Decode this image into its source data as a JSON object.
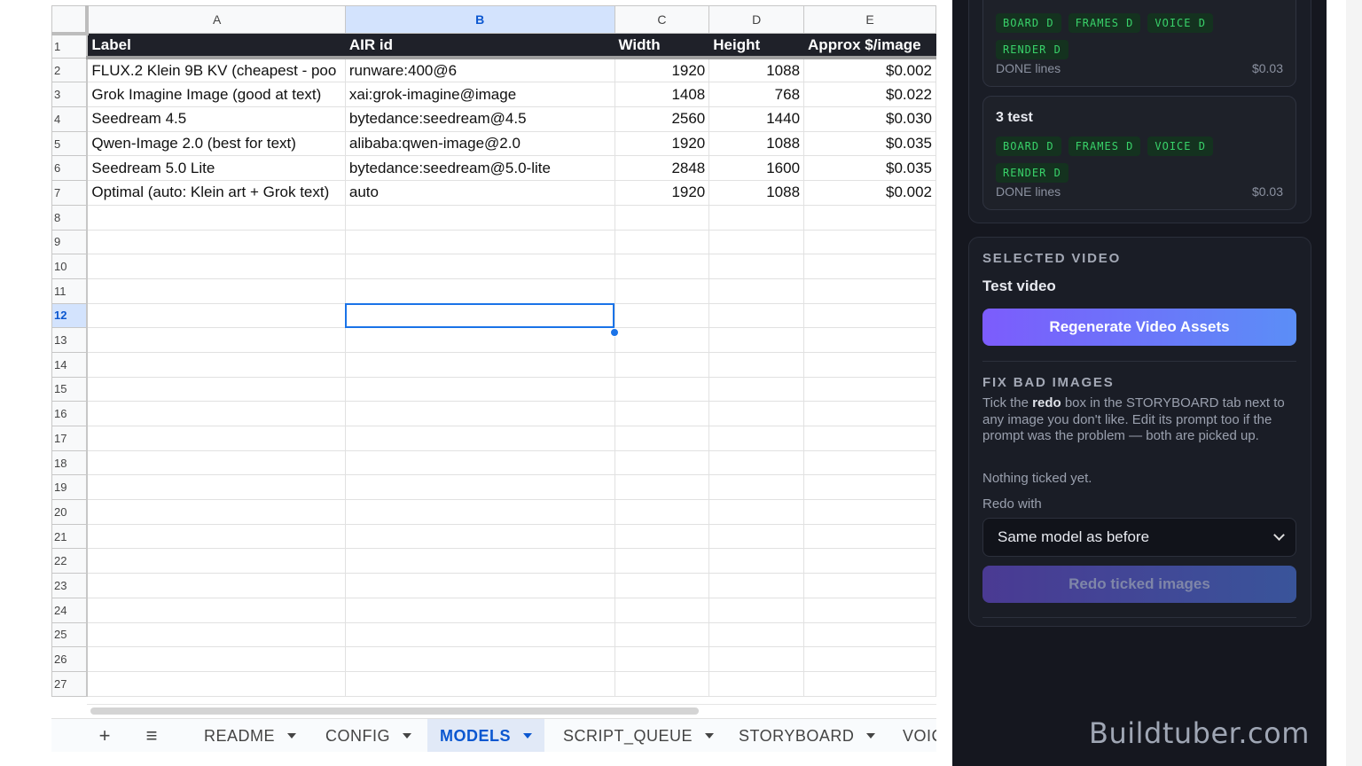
{
  "spreadsheet": {
    "columns": [
      "A",
      "B",
      "C",
      "D",
      "E"
    ],
    "selected_column": "B",
    "selected_row": 12,
    "header": [
      "Label",
      "AIR id",
      "Width",
      "Height",
      "Approx $/image"
    ],
    "rows": [
      [
        "FLUX.2 Klein 9B KV (cheapest - poo",
        "runware:400@6",
        "1920",
        "1088",
        "$0.002"
      ],
      [
        "Grok Imagine Image (good at text)",
        "xai:grok-imagine@image",
        "1408",
        "768",
        "$0.022"
      ],
      [
        "Seedream 4.5",
        "bytedance:seedream@4.5",
        "2560",
        "1440",
        "$0.030"
      ],
      [
        "Qwen-Image 2.0 (best for text)",
        "alibaba:qwen-image@2.0",
        "1920",
        "1088",
        "$0.035"
      ],
      [
        "Seedream 5.0 Lite",
        "bytedance:seedream@5.0-lite",
        "2848",
        "1600",
        "$0.035"
      ],
      [
        "Optimal (auto: Klein art + Grok text)",
        "auto",
        "1920",
        "1088",
        "$0.002"
      ]
    ],
    "row_numbers": [
      "1",
      "2",
      "3",
      "4",
      "5",
      "6",
      "7",
      "8",
      "9",
      "10",
      "11",
      "12",
      "13",
      "14",
      "15",
      "16",
      "17",
      "18",
      "19",
      "20",
      "21",
      "22",
      "23",
      "24",
      "25",
      "26",
      "27"
    ]
  },
  "sheet_tabs": {
    "add_label": "+",
    "list_label": "≡",
    "tabs": [
      "README",
      "CONFIG",
      "MODELS",
      "SCRIPT_QUEUE",
      "STORYBOARD",
      "VOIC"
    ],
    "active": "MODELS"
  },
  "panel": {
    "card1": {
      "badges": [
        "BOARD D",
        "FRAMES D",
        "VOICE D",
        "RENDER D"
      ],
      "status": "DONE lines",
      "price": "$0.03"
    },
    "card2": {
      "title": "3 test",
      "badges": [
        "BOARD D",
        "FRAMES D",
        "VOICE D",
        "RENDER D"
      ],
      "status": "DONE lines",
      "price": "$0.03"
    },
    "selected_video_label": "SELECTED VIDEO",
    "selected_video_name": "Test video",
    "regenerate_button": "Regenerate Video Assets",
    "fix_label": "FIX BAD IMAGES",
    "fix_text_pre": "Tick the ",
    "fix_text_bold": "redo",
    "fix_text_post": " box in the STORYBOARD tab next to any image you don't like. Edit its prompt too if the prompt was the problem — both are picked up.",
    "nothing_ticked": "Nothing ticked yet.",
    "redo_with_label": "Redo with",
    "redo_select_value": "Same model as before",
    "redo_button": "Redo ticked images"
  },
  "watermark": "Buildtuber.com",
  "colors": {
    "accent_start": "#7c5cfc",
    "accent_end": "#5b8ef7",
    "badge_green": "#39d26a",
    "sheet_selection": "#1a73e8"
  }
}
